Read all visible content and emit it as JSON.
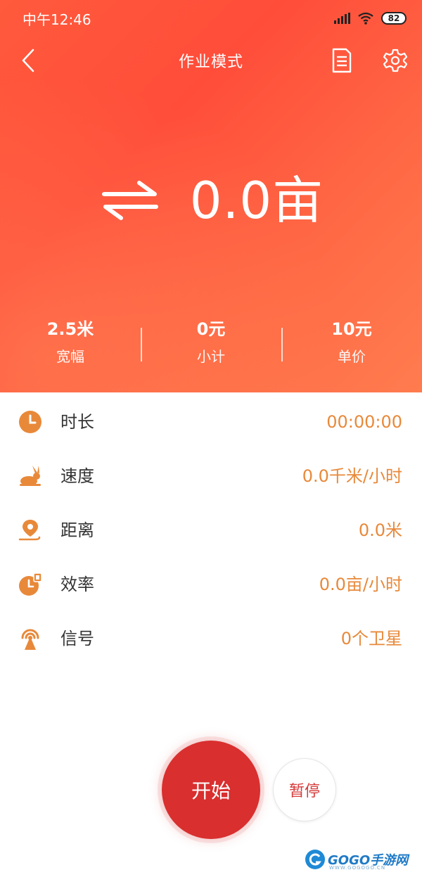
{
  "status_bar": {
    "time": "中午12:46",
    "battery": "82"
  },
  "nav": {
    "title": "作业模式"
  },
  "main": {
    "area_value": "0.0亩"
  },
  "stats": [
    {
      "value": "2.5米",
      "label": "宽幅"
    },
    {
      "value": "0元",
      "label": "小计"
    },
    {
      "value": "10元",
      "label": "单价"
    }
  ],
  "rows": [
    {
      "label": "时长",
      "value": "00:00:00",
      "icon": "clock-icon"
    },
    {
      "label": "速度",
      "value": "0.0千米/小时",
      "icon": "rabbit-icon"
    },
    {
      "label": "距离",
      "value": "0.0米",
      "icon": "location-pin-icon"
    },
    {
      "label": "效率",
      "value": "0.0亩/小时",
      "icon": "stopwatch-icon"
    },
    {
      "label": "信号",
      "value": "0个卫星",
      "icon": "signal-tower-icon"
    }
  ],
  "actions": {
    "start": "开始",
    "pause": "暂停"
  },
  "watermark": {
    "brand": "GOGO手游网",
    "domain": "WWW.GOGOGO.CN"
  },
  "colors": {
    "header_start": "#ff5a3c",
    "header_end": "#ff7c4f",
    "accent": "#e8893a",
    "start_button": "#d92f2f"
  }
}
